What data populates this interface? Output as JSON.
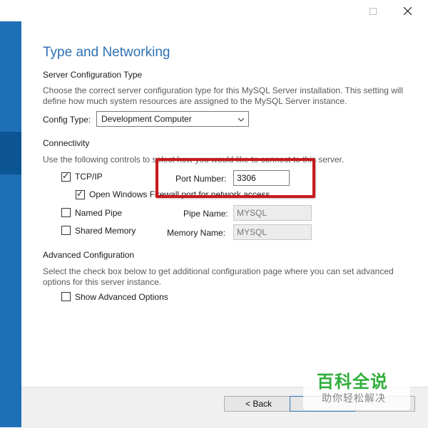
{
  "page_title": "Type and Networking",
  "server_config": {
    "heading": "Server Configuration Type",
    "description_line1": "Choose the correct server configuration type for this MySQL Server installation. This setting will",
    "description_line2": "define how much system resources are assigned to the MySQL Server instance.",
    "config_type_label": "Config Type:",
    "config_type_value": "Development Computer"
  },
  "connectivity": {
    "heading": "Connectivity",
    "description": "Use the following controls to select how you would like to connect to this server.",
    "tcpip_label": "TCP/IP",
    "tcpip_checked": true,
    "port_number_label": "Port Number:",
    "port_number_value": "3306",
    "firewall_label": "Open Windows Firewall port for network access",
    "firewall_checked": true,
    "named_pipe_label": "Named Pipe",
    "named_pipe_checked": false,
    "pipe_name_label": "Pipe Name:",
    "pipe_name_value": "MYSQL",
    "shared_memory_label": "Shared Memory",
    "shared_memory_checked": false,
    "memory_name_label": "Memory Name:",
    "memory_name_value": "MYSQL"
  },
  "advanced": {
    "heading": "Advanced Configuration",
    "description_line1": "Select the check box below to get additional configuration page where you can set advanced",
    "description_line2": "options for this server instance.",
    "show_advanced_label": "Show Advanced Options",
    "show_advanced_checked": false
  },
  "footer": {
    "back_label": "< Back",
    "next_label": "",
    "cancel_label": ""
  },
  "watermark": {
    "title": "百科全说",
    "subtitle": "助你轻松解决"
  },
  "colors": {
    "accent": "#2f71b5",
    "side_panel": "#1e6fb5",
    "highlight": "#c8191b",
    "watermark_green": "#2fae3b"
  },
  "icons": {
    "minimize": "minimize-icon",
    "maximize": "maximize-icon",
    "close": "close-icon",
    "dropdown": "chevron-down-icon",
    "check": "checkmark-icon"
  }
}
